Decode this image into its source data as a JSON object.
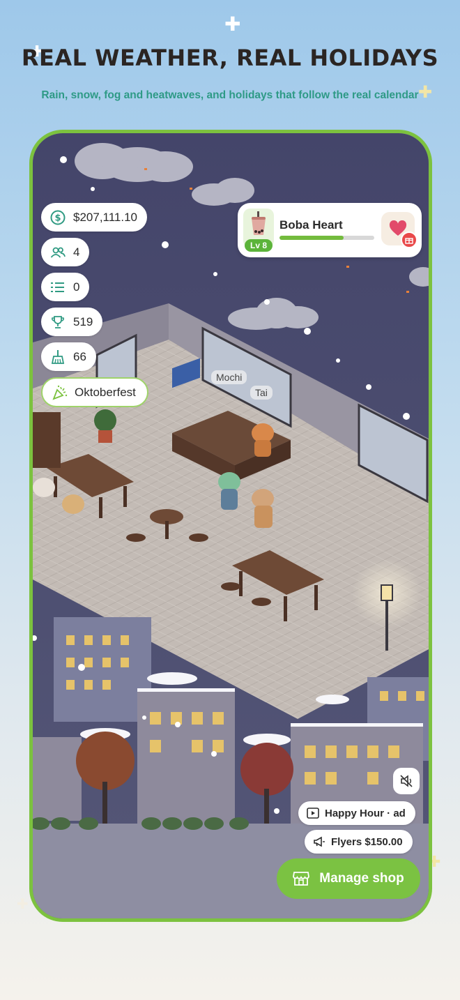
{
  "headline": "REAL WEATHER, REAL HOLIDAYS",
  "subheadline": "Rain, snow, fog and heatwaves, and holidays that follow the real calendar",
  "stats": {
    "money": {
      "value": "$207,111.10",
      "icon": "dollar-circle-icon"
    },
    "staff": {
      "value": "4",
      "icon": "people-icon"
    },
    "orders": {
      "value": "0",
      "icon": "list-icon"
    },
    "trophies": {
      "value": "519",
      "icon": "trophy-icon"
    },
    "cleanliness": {
      "value": "66",
      "icon": "broom-icon"
    }
  },
  "holiday": {
    "label": "Oktoberfest",
    "icon": "party-popper-icon"
  },
  "featured_drink": {
    "name": "Boba Heart",
    "level": "Lv 8",
    "xp_progress": 0.68,
    "icons": [
      "boba-cup-icon",
      "heart-icon",
      "gift-icon"
    ]
  },
  "characters": [
    {
      "name": "Mochi"
    },
    {
      "name": "Tai"
    }
  ],
  "controls": {
    "mute_icon": "speaker-muted-icon",
    "happy_hour": "Happy Hour · ad",
    "flyers": "Flyers $150.00",
    "manage_shop": "Manage shop"
  },
  "colors": {
    "frame": "#7cc23f",
    "accent_green": "#7bc242",
    "subheadline": "#2e9a86",
    "night_sky": "#4a4b6c"
  }
}
